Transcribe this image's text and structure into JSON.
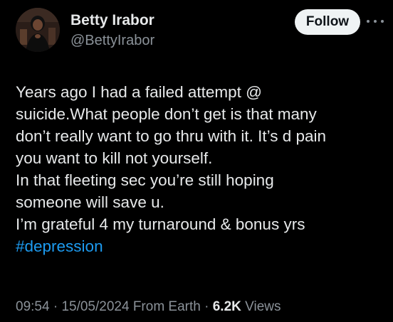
{
  "author": {
    "display_name": "Betty Irabor",
    "handle": "@BettyIrabor"
  },
  "actions": {
    "follow_label": "Follow",
    "more_icon": "more-horizontal-icon"
  },
  "tweet": {
    "lines": [
      "Years ago I had a failed attempt @",
      "suicide.What people don’t get is that many",
      "don’t really want to go thru with it. It’s d pain",
      "you want to kill not yourself.",
      "In that fleeting sec you’re  still hoping",
      "someone will save u.",
      "I’m grateful 4 my turnaround & bonus yrs"
    ],
    "hashtag": "#depression"
  },
  "meta": {
    "time": "09:54",
    "date": "15/05/2024",
    "source": "From Earth",
    "views_count": "6.2K",
    "views_label": "Views",
    "separator": " · "
  },
  "colors": {
    "background": "#000000",
    "text": "#e7e9ea",
    "secondary": "#8b9299",
    "hashtag": "#1d9bf0",
    "follow_bg": "#eff3f4"
  }
}
